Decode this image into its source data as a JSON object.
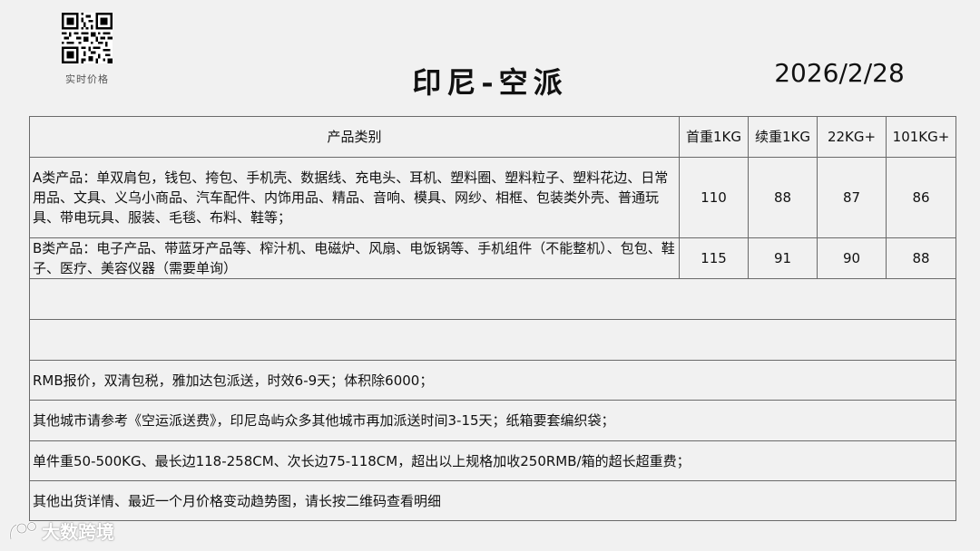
{
  "header": {
    "qr_caption": "实时价格",
    "title": "印尼-空派",
    "date": "2026/2/28"
  },
  "table": {
    "columns": [
      "产品类别",
      "首重1KG",
      "续重1KG",
      "22KG+",
      "101KG+"
    ],
    "rows": [
      {
        "category": "A类产品：单双肩包，钱包、挎包、手机壳、数据线、充电头、耳机、塑料圈、塑料粒子、塑料花边、日常用品、文具、义乌小商品、汽车配件、内饰用品、精品、音响、模具、网纱、相框、包装类外壳、普通玩具、带电玩具、服装、毛毯、布料、鞋等；",
        "first_kg": "110",
        "extra_kg": "88",
        "kg22": "87",
        "kg101": "86"
      },
      {
        "category": "B类产品：电子产品、带蓝牙产品等、榨汁机、电磁炉、风扇、电饭锅等、手机组件（不能整机）、包包、鞋子、医疗、美容仪器（需要单询）",
        "first_kg": "115",
        "extra_kg": "91",
        "kg22": "90",
        "kg101": "88"
      }
    ],
    "notes": [
      "RMB报价，双清包税，雅加达包派送，时效6-9天；体积除6000；",
      "其他城市请参考《空运派送费》，印尼岛屿众多其他城市再加派送时间3-15天；纸箱要套编织袋；",
      "单件重50-500KG、最长边118-258CM、次长边75-118CM，超出以上规格加收250RMB/箱的超长超重费；",
      "其他出货详情、最近一个月价格变动趋势图，请长按二维码查看明细"
    ]
  },
  "watermark": {
    "text": "大数跨境"
  }
}
